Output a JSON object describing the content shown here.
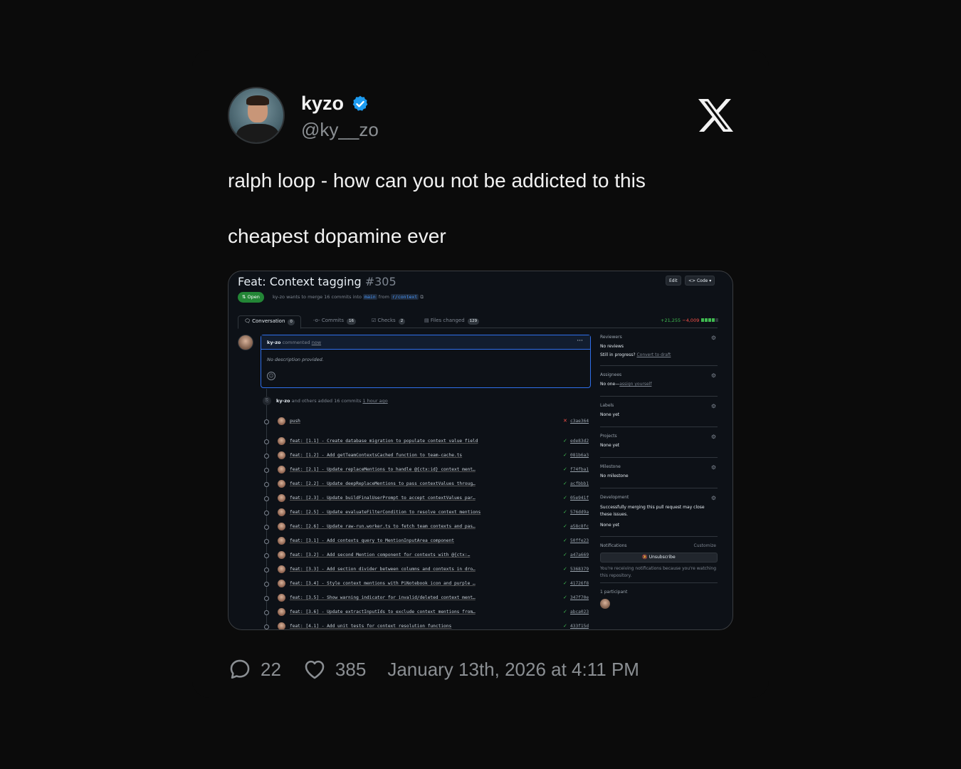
{
  "tweet": {
    "name": "kyzo",
    "handle": "@ky__zo",
    "text_line1": "ralph loop - how can you not be addicted to this",
    "text_line2": "cheapest dopamine ever",
    "replies": "22",
    "likes": "385",
    "date": "January 13th, 2026 at 4:11 PM"
  },
  "colors": {
    "verified": "#1d9bf0",
    "background": "#0b0b0b",
    "open_badge": "#238636"
  },
  "screenshot": {
    "title": "Feat: Context tagging",
    "number": "#305",
    "edit_label": "Edit",
    "code_label": "<> Code ▾",
    "status": "Open",
    "merge_text_pre": "ky-zo wants to merge 16 commits into",
    "base_branch": "main",
    "merge_text_from": "from",
    "head_branch": "r/context",
    "tabs": [
      {
        "label": "Conversation",
        "count": "0"
      },
      {
        "label": "Commits",
        "count": "16"
      },
      {
        "label": "Checks",
        "count": "2"
      },
      {
        "label": "Files changed",
        "count": "129"
      }
    ],
    "additions": "+21,255",
    "deletions": "−4,009",
    "comment": {
      "author": "ky-zo",
      "action": "commented",
      "time": "now",
      "body": "No description provided."
    },
    "added_author": "ky-zo",
    "added_text": "and others added 16 commits",
    "added_time": "1 hour ago",
    "commits": [
      {
        "msg": "push",
        "sha": "c3ae364",
        "status": "fail"
      },
      {
        "msg": "feat: [1.1] - Create database migration to populate context value field",
        "sha": "ede83d2",
        "status": "pass"
      },
      {
        "msg": "feat: [1.2] - Add getTeamContextsCached function to team-cache.ts",
        "sha": "081b6a3",
        "status": "pass"
      },
      {
        "msg": "feat: [2.1] - Update replaceMentions to handle @{ctx:id} context ment…",
        "sha": "f74fba1",
        "status": "pass"
      },
      {
        "msg": "feat: [2.2] - Update deepReplaceMentions to pass contextValues throug…",
        "sha": "acfbbb1",
        "status": "pass"
      },
      {
        "msg": "feat: [2.3] - Update buildFinalUserPrompt to accept contextValues par…",
        "sha": "05e941f",
        "status": "pass"
      },
      {
        "msg": "feat: [2.5] - Update evaluateFilterCondition to resolve context mentions",
        "sha": "576dd9a",
        "status": "pass"
      },
      {
        "msg": "feat: [2.6] - Update raw-run.worker.ts to fetch team contexts and pas…",
        "sha": "a58c8fc",
        "status": "pass"
      },
      {
        "msg": "feat: [3.1] - Add contexts query to MentionInputArea component",
        "sha": "50ffe23",
        "status": "pass"
      },
      {
        "msg": "feat: [3.2] - Add second Mention component for contexts with @{ctx:…",
        "sha": "a47a669",
        "status": "pass"
      },
      {
        "msg": "feat: [3.3] - Add section divider between columns and contexts in dro…",
        "sha": "5368379",
        "status": "pass"
      },
      {
        "msg": "feat: [3.4] - Style context mentions with PiNotebook icon and purple …",
        "sha": "41726f8",
        "status": "pass"
      },
      {
        "msg": "feat: [3.5] - Show warning indicator for invalid/deleted context ment…",
        "sha": "347f70e",
        "status": "pass"
      },
      {
        "msg": "feat: [3.6] - Update extractInputIds to exclude context mentions from…",
        "sha": "abca023",
        "status": "pass"
      },
      {
        "msg": "feat: [4.1] - Add unit tests for context resolution functions",
        "sha": "433f15d",
        "status": "pass"
      }
    ],
    "sidebar": {
      "reviewers_h": "Reviewers",
      "reviewers_v": "No reviews",
      "reviewers_v2": "Still in progress?",
      "reviewers_link": "Convert to draft",
      "assignees_h": "Assignees",
      "assignees_v": "No one—",
      "assignees_link": "assign yourself",
      "labels_h": "Labels",
      "labels_v": "None yet",
      "projects_h": "Projects",
      "projects_v": "None yet",
      "milestone_h": "Milestone",
      "milestone_v": "No milestone",
      "development_h": "Development",
      "development_v": "Successfully merging this pull request may close these issues.",
      "development_v2": "None yet",
      "notifications_h": "Notifications",
      "customize": "Customize",
      "unsubscribe": "Unsubscribe",
      "notif_text": "You're receiving notifications because you're watching this repository.",
      "participants": "1 participant"
    }
  }
}
